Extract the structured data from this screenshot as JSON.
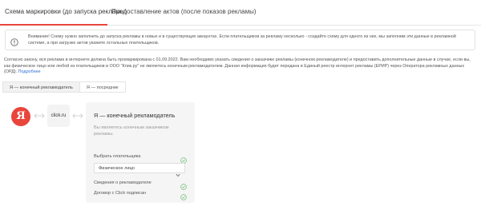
{
  "tabs": [
    {
      "label": "Схема маркировки (до запуска рекламы)",
      "active": true
    },
    {
      "label": "Предоставление актов (после показов рекламы)",
      "active": false
    }
  ],
  "warning": {
    "text": "Внимание! Схему нужно заполнить до запуска рекламы в новых и в существующих аккаунтах. Если плательщиков за рекламу несколько - создайте схему для одного из них, мы заполним эти данные в рекламной системе, а при загрузке актов укажите остальных плательщиков.",
    "icon": "info-circle-icon"
  },
  "law": {
    "text": "Согласно закону, вся реклама в интернете должна быть промаркирована с 01.09.2022. Вам необходимо указать сведения о заказчике рекламы (конечном рекламодателе) и предоставить дополнительные данные в случае, если вы, как физическое лицо или любой из плательщиков в ООО \"Клик.ру\" не являетесь конечным рекламодателем. Данная информация будет передана в Единый реестр интернет рекламы (ЕРИР) через Оператора рекламных данных (ОРД).",
    "more_link": "Подробнее"
  },
  "segment": {
    "options": [
      "Я — конечный рекламодатель",
      "Я — посредник"
    ],
    "selected": "Я — конечный рекламодатель"
  },
  "flow": {
    "yandex_letter": "Я",
    "click_label": "click.ru"
  },
  "panel": {
    "title": "Я — конечный рекламодатель",
    "description": "Вы являетесь конечным заказчиком рекламы.",
    "payer_label": "Выбрать плательщика",
    "payer_value": "Физическое лицо",
    "advertiser_info_label": "Сведения о рекламодателе",
    "contract_label": "Договор с Click подписан"
  },
  "colors": {
    "accent": "#e8453c",
    "check": "#6cc070",
    "link": "#2f6fd6"
  }
}
